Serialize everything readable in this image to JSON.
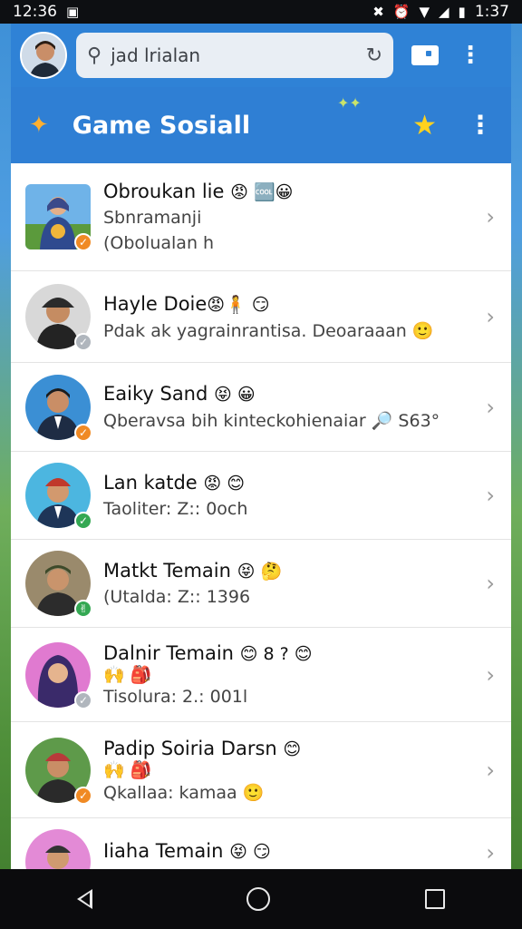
{
  "status_bar": {
    "time": "12:36",
    "right_time": "1:37"
  },
  "search": {
    "value": "jad lrialan"
  },
  "header": {
    "title": "Game Sosiall"
  },
  "contacts": [
    {
      "name": "Obroukan lie",
      "emoji": "😡 🆒😀",
      "line1": "Sbnramanji",
      "line2": "(Obolualan h",
      "status_color": "#f08a24",
      "status_glyph": "✓"
    },
    {
      "name": "Hayle Doie",
      "emoji": "😡🧍 😏",
      "line1": "Pdak ak yagrainrantisa. Deoaraaan 🙂",
      "line2": "",
      "status_color": "#b0b6bd",
      "status_glyph": "✓"
    },
    {
      "name": "Eaiky Sand",
      "emoji": "😝 😀",
      "line1": "Qberavsa bih kinteckohienaiar  🔎 S63°",
      "line2": "",
      "status_color": "#f08a24",
      "status_glyph": "✓"
    },
    {
      "name": "Lan katde",
      "emoji": "😡 😊",
      "line1": "Taoliter: Z:: 0och",
      "line2": "",
      "status_color": "#34a853",
      "status_glyph": "✓"
    },
    {
      "name": "Matkt Temain",
      "emoji": "😝 🤔",
      "line1": "(Utalda: Z:: 1396",
      "line2": "",
      "status_color": "#34a853",
      "status_glyph": "✌"
    },
    {
      "name": "Dalnir Temain",
      "emoji": "😊 8 ? 😊",
      "line1": "🙌 🎒",
      "line2": "Tisolura: 2.: 001l",
      "status_color": "#b0b6bd",
      "status_glyph": "✓"
    },
    {
      "name": "Padip Soiria Darsn",
      "emoji": "😊",
      "line1": "🙌 🎒",
      "line2": "Qkallaa: kamaa 🙂",
      "status_color": "#f08a24",
      "status_glyph": "✓"
    },
    {
      "name": "Iiaha Temain",
      "emoji": "😝 😏",
      "line1": "",
      "line2": "",
      "status_color": "#f08a24",
      "status_glyph": "✓"
    }
  ]
}
